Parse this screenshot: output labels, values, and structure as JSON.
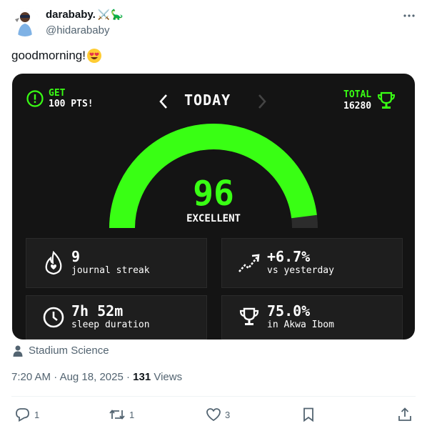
{
  "author": {
    "name": "darababy.",
    "name_emoji": "⚔️🦕",
    "handle": "@hidarababy"
  },
  "tweet": {
    "text": "goodmorning!",
    "emoji": "heart-eyes-emoji"
  },
  "media": {
    "points": {
      "get_label": "GET",
      "amount_label": "100 PTS!"
    },
    "period": "TODAY",
    "total": {
      "label": "TOTAL",
      "value": "16280"
    },
    "score": {
      "value": "96",
      "label": "EXCELLENT",
      "fraction": 0.96
    },
    "stats": [
      {
        "icon": "flame-heart-icon",
        "value": "9",
        "label": "journal streak"
      },
      {
        "icon": "trend-up-icon",
        "value": "+6.7%",
        "label": "vs yesterday"
      },
      {
        "icon": "clock-icon",
        "value": "7h 52m",
        "label": "sleep duration"
      },
      {
        "icon": "trophy-icon",
        "value": "75.0%",
        "label": "in Akwa Ibom"
      }
    ],
    "colors": {
      "accent": "#39ff14",
      "background": "#141414",
      "tile": "#1e1e1e"
    }
  },
  "attribution": "Stadium Science",
  "meta": {
    "time": "7:20 AM",
    "separator": " · ",
    "date": "Aug 18, 2025",
    "views_count": "131",
    "views_label": "Views"
  },
  "actions": {
    "replies": "1",
    "reposts": "1",
    "likes": "3"
  }
}
